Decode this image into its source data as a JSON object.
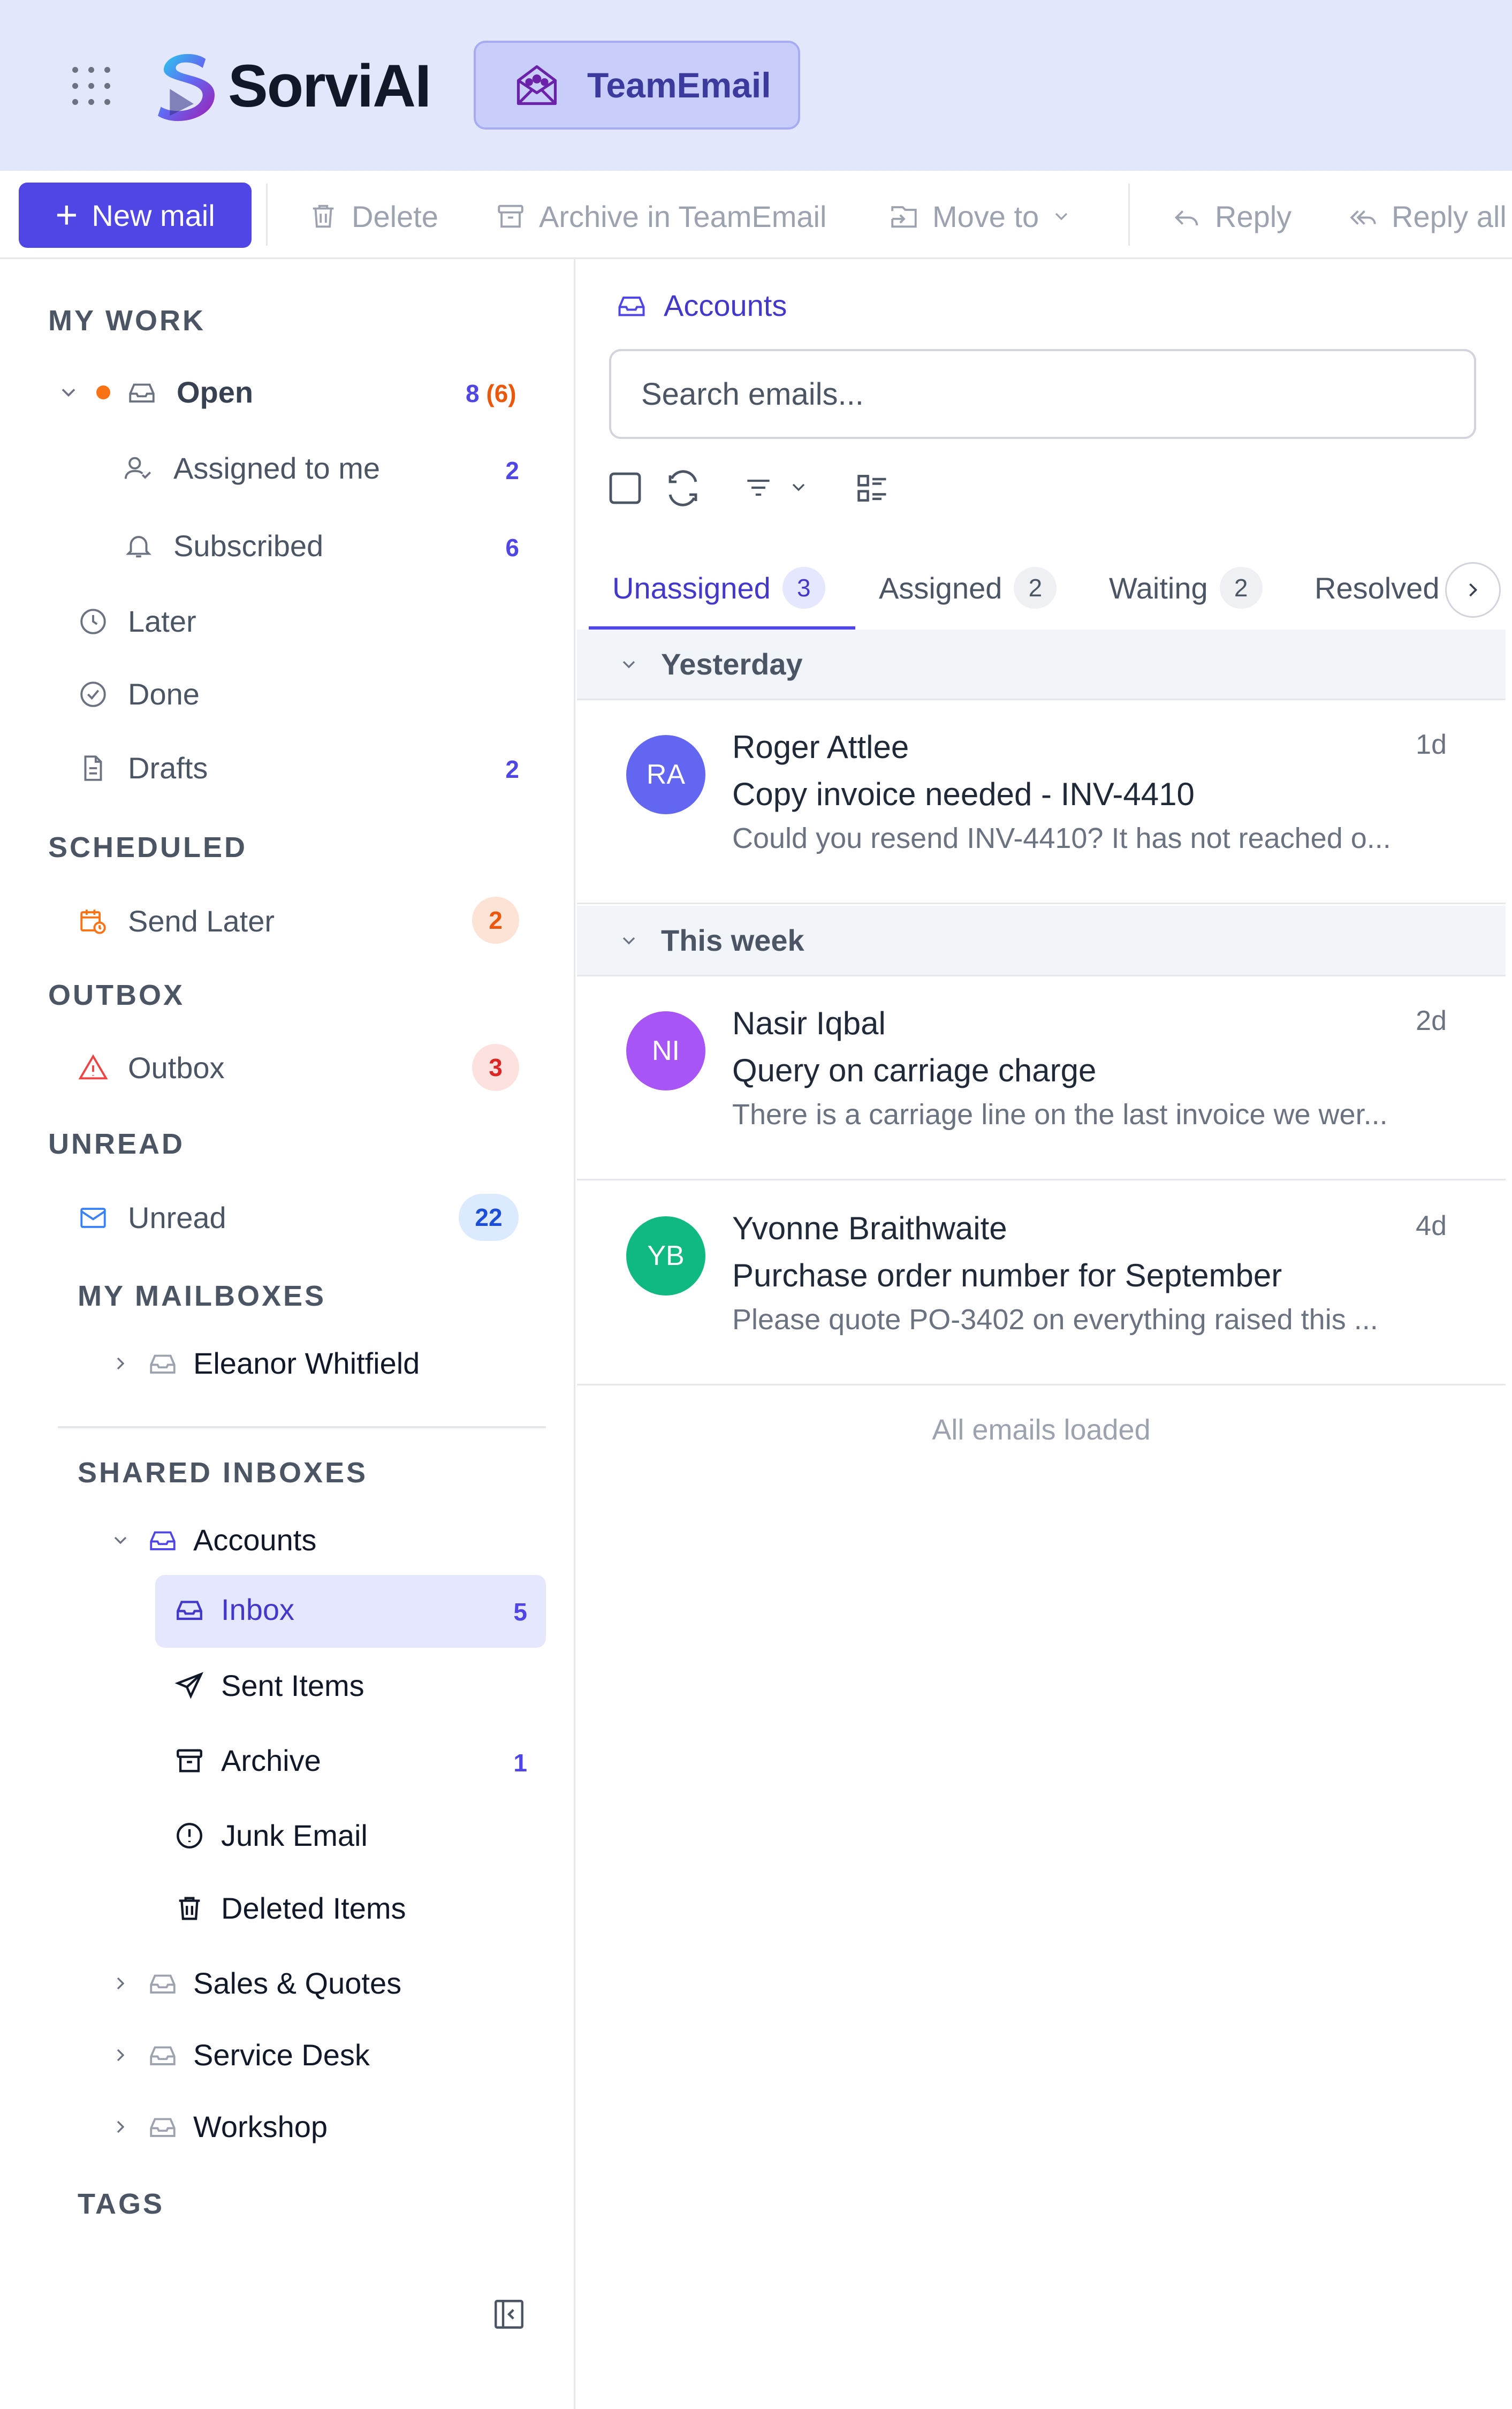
{
  "header": {
    "brand": "SorviAI",
    "app_pill": "TeamEmail"
  },
  "toolbar": {
    "new_mail": "New mail",
    "delete": "Delete",
    "archive": "Archive in TeamEmail",
    "move_to": "Move to",
    "reply": "Reply",
    "reply_all": "Reply all"
  },
  "sidebar": {
    "my_work": {
      "title": "MY WORK",
      "open": {
        "label": "Open",
        "count": "8",
        "count_sub": "(6)"
      },
      "assigned": {
        "label": "Assigned to me",
        "count": "2"
      },
      "subscribed": {
        "label": "Subscribed",
        "count": "6"
      },
      "later": {
        "label": "Later"
      },
      "done": {
        "label": "Done"
      },
      "drafts": {
        "label": "Drafts",
        "count": "2"
      }
    },
    "scheduled": {
      "title": "SCHEDULED",
      "send_later": {
        "label": "Send Later",
        "count": "2"
      }
    },
    "outbox": {
      "title": "OUTBOX",
      "item": {
        "label": "Outbox",
        "count": "3"
      }
    },
    "unread": {
      "title": "UNREAD",
      "item": {
        "label": "Unread",
        "count": "22"
      }
    },
    "my_mailboxes": {
      "title": "MY MAILBOXES",
      "eleanor": "Eleanor Whitfield"
    },
    "shared": {
      "title": "SHARED INBOXES",
      "accounts": "Accounts",
      "inbox": {
        "label": "Inbox",
        "count": "5"
      },
      "sent": "Sent Items",
      "archive": {
        "label": "Archive",
        "count": "1"
      },
      "junk": "Junk Email",
      "deleted": "Deleted Items",
      "sales": "Sales & Quotes",
      "service": "Service Desk",
      "workshop": "Workshop"
    },
    "tags": {
      "title": "TAGS"
    }
  },
  "main": {
    "breadcrumb": "Accounts",
    "search_placeholder": "Search emails...",
    "tabs": [
      {
        "label": "Unassigned",
        "count": "3"
      },
      {
        "label": "Assigned",
        "count": "2"
      },
      {
        "label": "Waiting",
        "count": "2"
      },
      {
        "label": "Resolved"
      }
    ],
    "groups": {
      "yesterday": "Yesterday",
      "this_week": "This week"
    },
    "emails": [
      {
        "initials": "RA",
        "color": "#6366f1",
        "from": "Roger Attlee",
        "time": "1d",
        "subject": "Copy invoice needed - INV-4410",
        "preview": "Could you resend INV-4410? It has not reached o..."
      },
      {
        "initials": "NI",
        "color": "#a855f7",
        "from": "Nasir Iqbal",
        "time": "2d",
        "subject": "Query on carriage charge",
        "preview": "There is a carriage line on the last invoice we wer..."
      },
      {
        "initials": "YB",
        "color": "#10b981",
        "from": "Yvonne Braithwaite",
        "time": "4d",
        "subject": "Purchase order number for September",
        "preview": "Please quote PO-3402 on everything raised this ..."
      }
    ],
    "footer": "All emails loaded"
  },
  "colors": {
    "accent": "#4f46e5",
    "header_bg": "#e3e7fc",
    "orange": "#f97316",
    "red": "#ef4444",
    "blue": "#3b82f6"
  },
  "icons": [
    "apps-grid-icon",
    "sorvi-logo-icon",
    "team-email-icon",
    "plus-icon",
    "trash-icon",
    "archive-icon",
    "move-icon",
    "chevron-down-icon",
    "reply-icon",
    "reply-all-icon",
    "inbox-icon",
    "user-check-icon",
    "bell-icon",
    "clock-icon",
    "check-circle-icon",
    "document-icon",
    "calendar-clock-icon",
    "warning-icon",
    "mail-icon",
    "chevron-right-icon",
    "send-icon",
    "alert-circle-icon",
    "collapse-sidebar-icon",
    "checkbox-icon",
    "refresh-icon",
    "filter-icon",
    "view-icon"
  ]
}
